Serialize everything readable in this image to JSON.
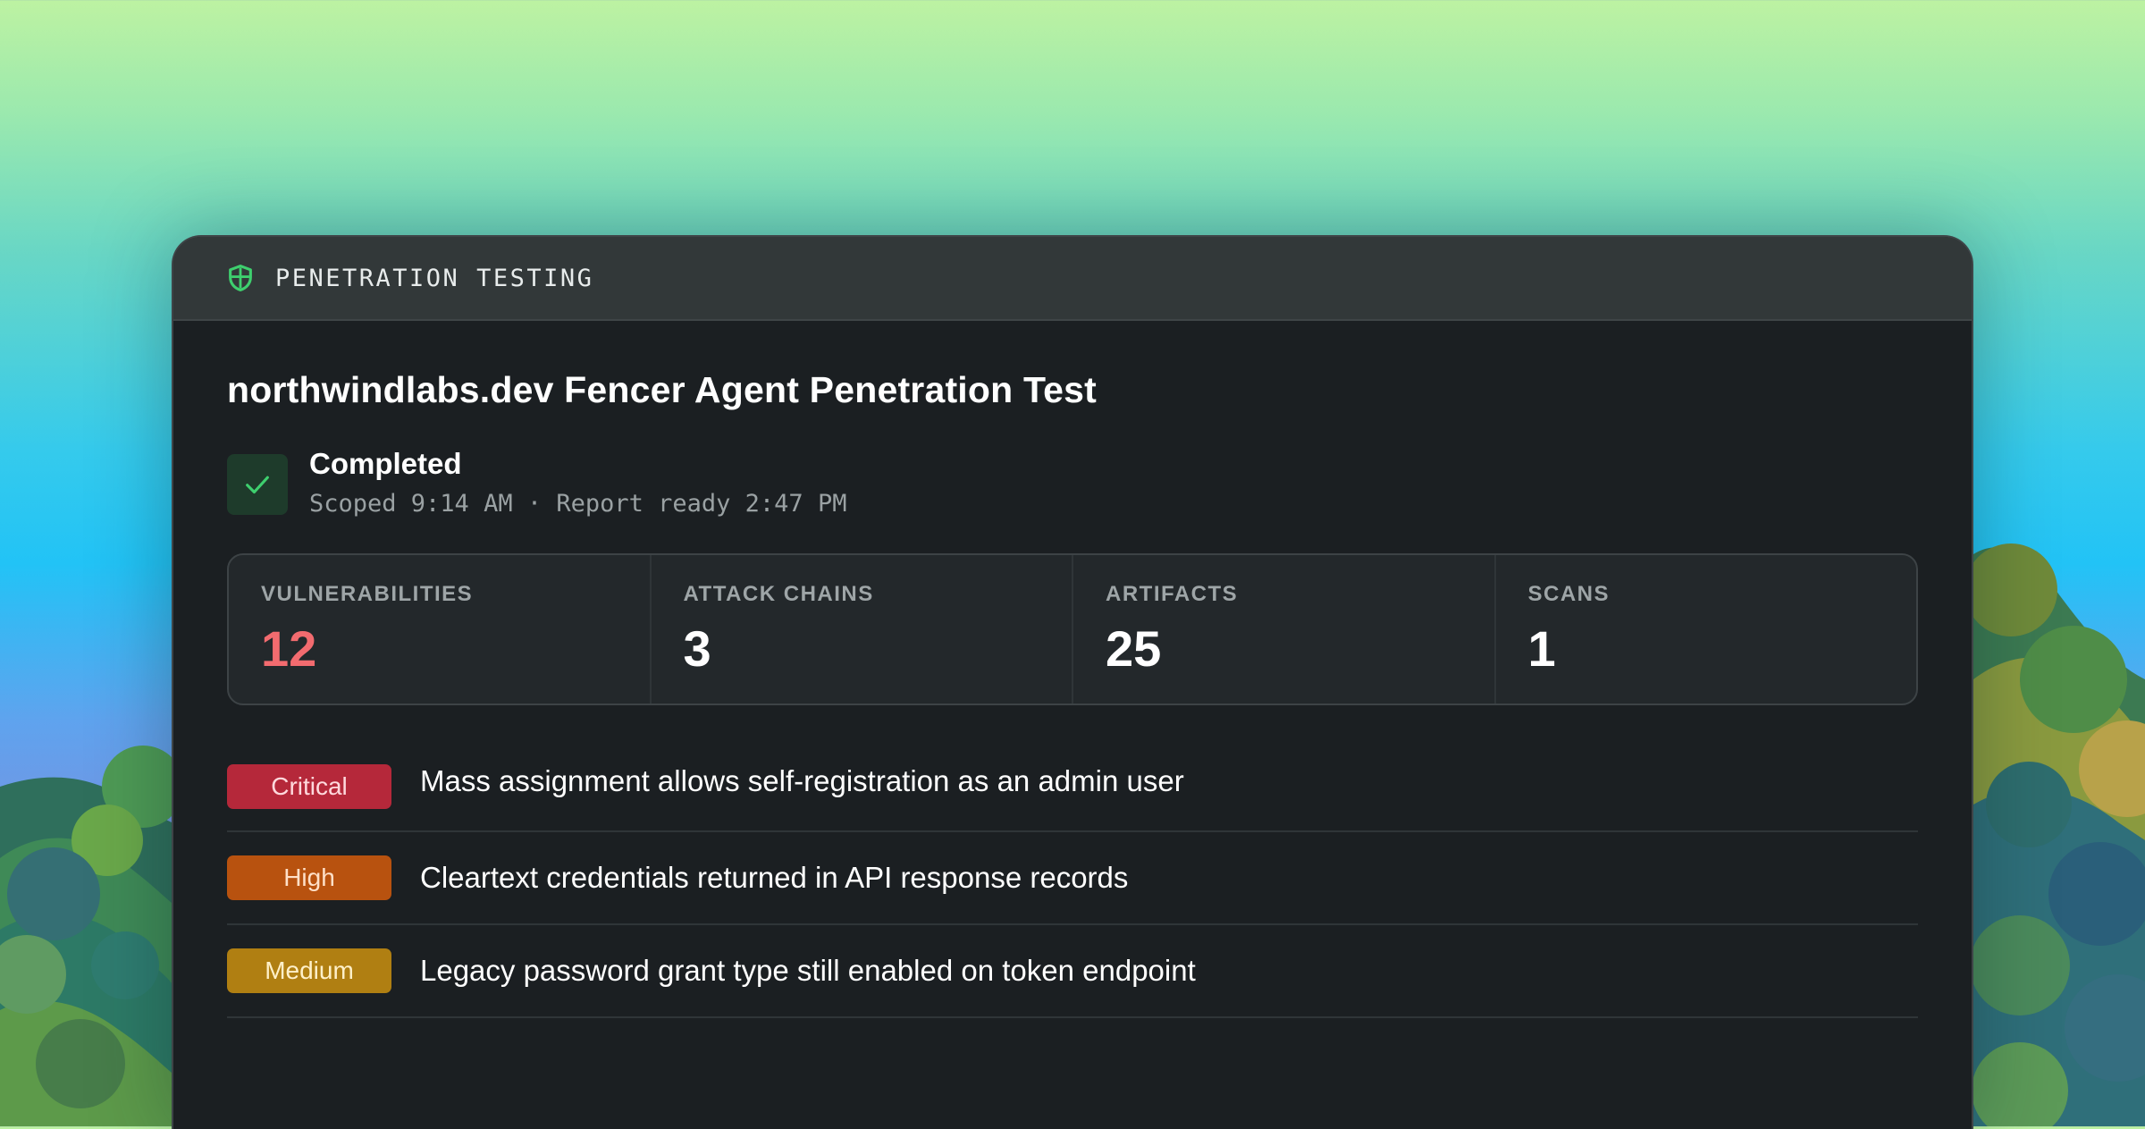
{
  "header": {
    "label": "PENETRATION TESTING",
    "icon": "shield-icon",
    "accent": "#3ecf6e"
  },
  "title": "northwindlabs.dev Fencer Agent Penetration Test",
  "status": {
    "title": "Completed",
    "subtitle": "Scoped 9:14 AM · Report ready 2:47 PM",
    "icon": "check-icon"
  },
  "stats": [
    {
      "label": "VULNERABILITIES",
      "value": "12",
      "color": "#f26b6f"
    },
    {
      "label": "ATTACK CHAINS",
      "value": "3"
    },
    {
      "label": "ARTIFACTS",
      "value": "25"
    },
    {
      "label": "SCANS",
      "value": "1"
    }
  ],
  "findings": [
    {
      "severity": "Critical",
      "text": "Mass assignment allows self-registration as an admin user",
      "color": "#b5283a"
    },
    {
      "severity": "High",
      "text": "Cleartext credentials returned in API response records",
      "color": "#b8520f"
    },
    {
      "severity": "Medium",
      "text": "Legacy password grant type still enabled on token endpoint",
      "color": "#b07f12"
    }
  ]
}
